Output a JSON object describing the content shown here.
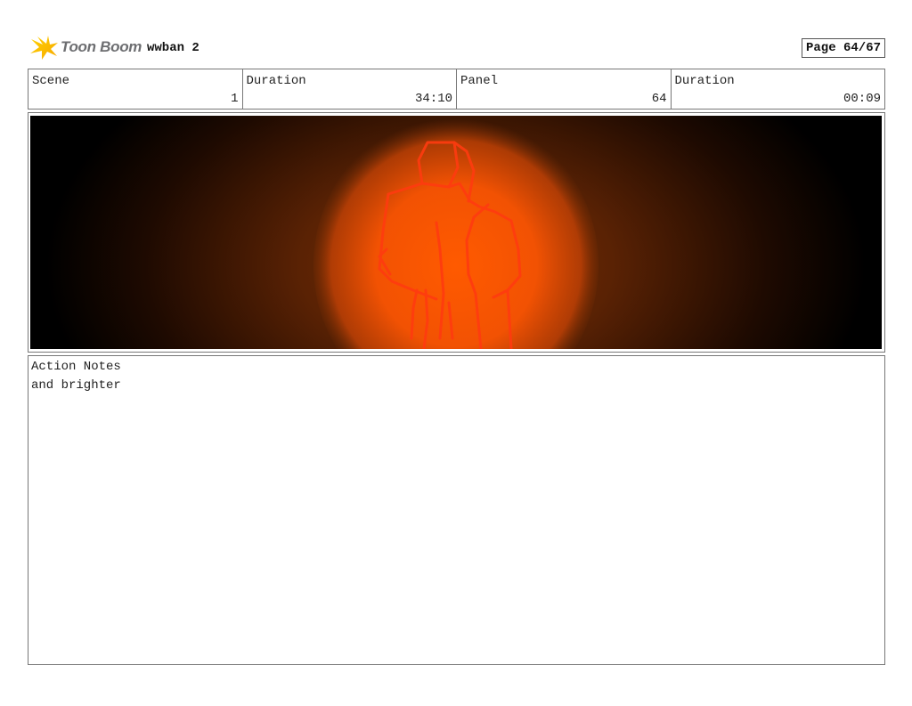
{
  "header": {
    "logo_text": "Toon Boom",
    "project_title": "wwban 2",
    "page_label": "Page 64/67"
  },
  "info": [
    {
      "label": "Scene",
      "value": "1"
    },
    {
      "label": "Duration",
      "value": "34:10"
    },
    {
      "label": "Panel",
      "value": "64"
    },
    {
      "label": "Duration",
      "value": "00:09"
    }
  ],
  "panel": {
    "glow_color": "#ff5a00",
    "sketch_color": "#ff3b10",
    "background_color": "#000000"
  },
  "notes": {
    "label": "Action Notes",
    "text": "and brighter"
  }
}
